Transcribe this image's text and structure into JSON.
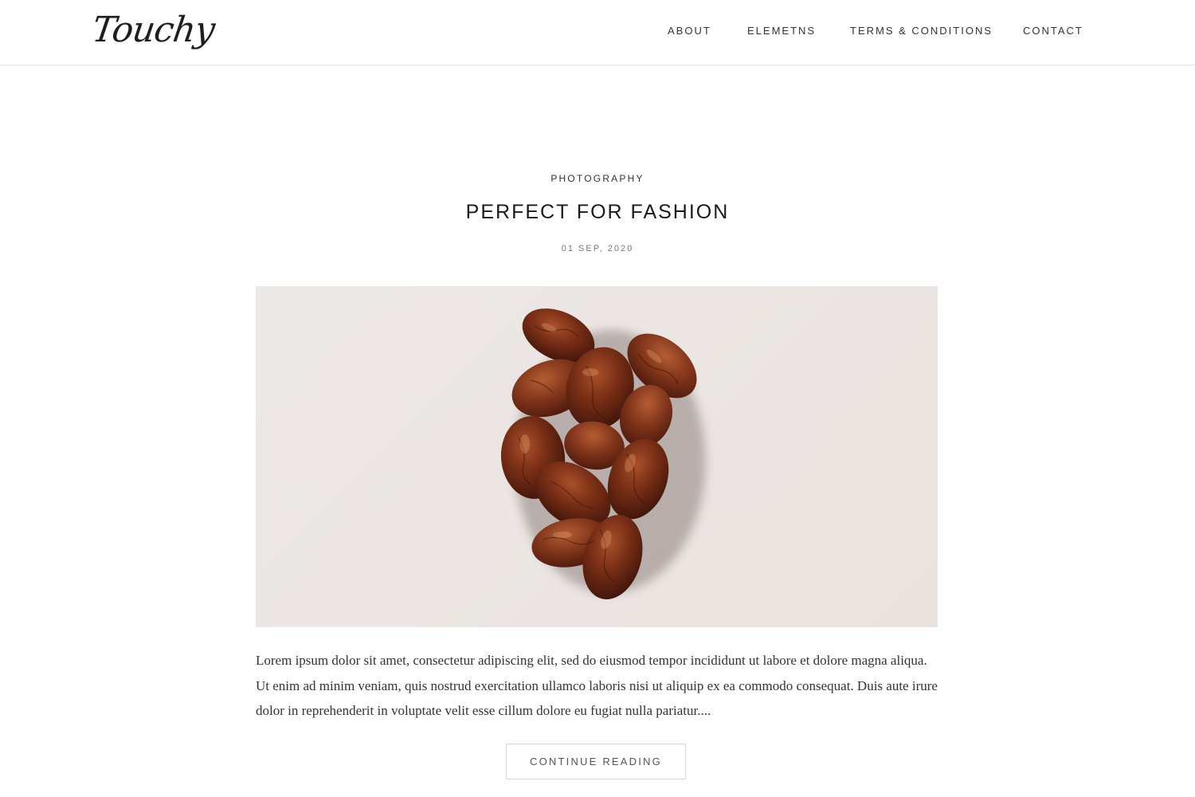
{
  "header": {
    "logo_text": "Touchy",
    "nav": [
      {
        "label": "ABOUT"
      },
      {
        "label": "ELEMETNS"
      },
      {
        "label": "TERMS & CONDITIONS"
      },
      {
        "label": "CONTACT"
      }
    ]
  },
  "post": {
    "category": "PHOTOGRAPHY",
    "title": "PERFECT FOR FASHION",
    "date": "01 SEP, 2020",
    "image_alt": "Pile of dried dates on a light background",
    "excerpt": "Lorem ipsum dolor sit amet, consectetur adipiscing elit, sed do eiusmod tempor incididunt ut labore et dolore magna aliqua. Ut enim ad minim veniam, quis nostrud exercitation ullamco laboris nisi ut aliquip ex ea commodo consequat. Duis aute irure dolor in reprehenderit in voluptate velit esse cillum dolore eu fugiat nulla pariatur....",
    "continue_label": "CONTINUE READING"
  },
  "colors": {
    "text": "#222222",
    "muted": "#777777",
    "image_bg": "#ebe6e3",
    "date_fruit": "#6b2a14"
  }
}
